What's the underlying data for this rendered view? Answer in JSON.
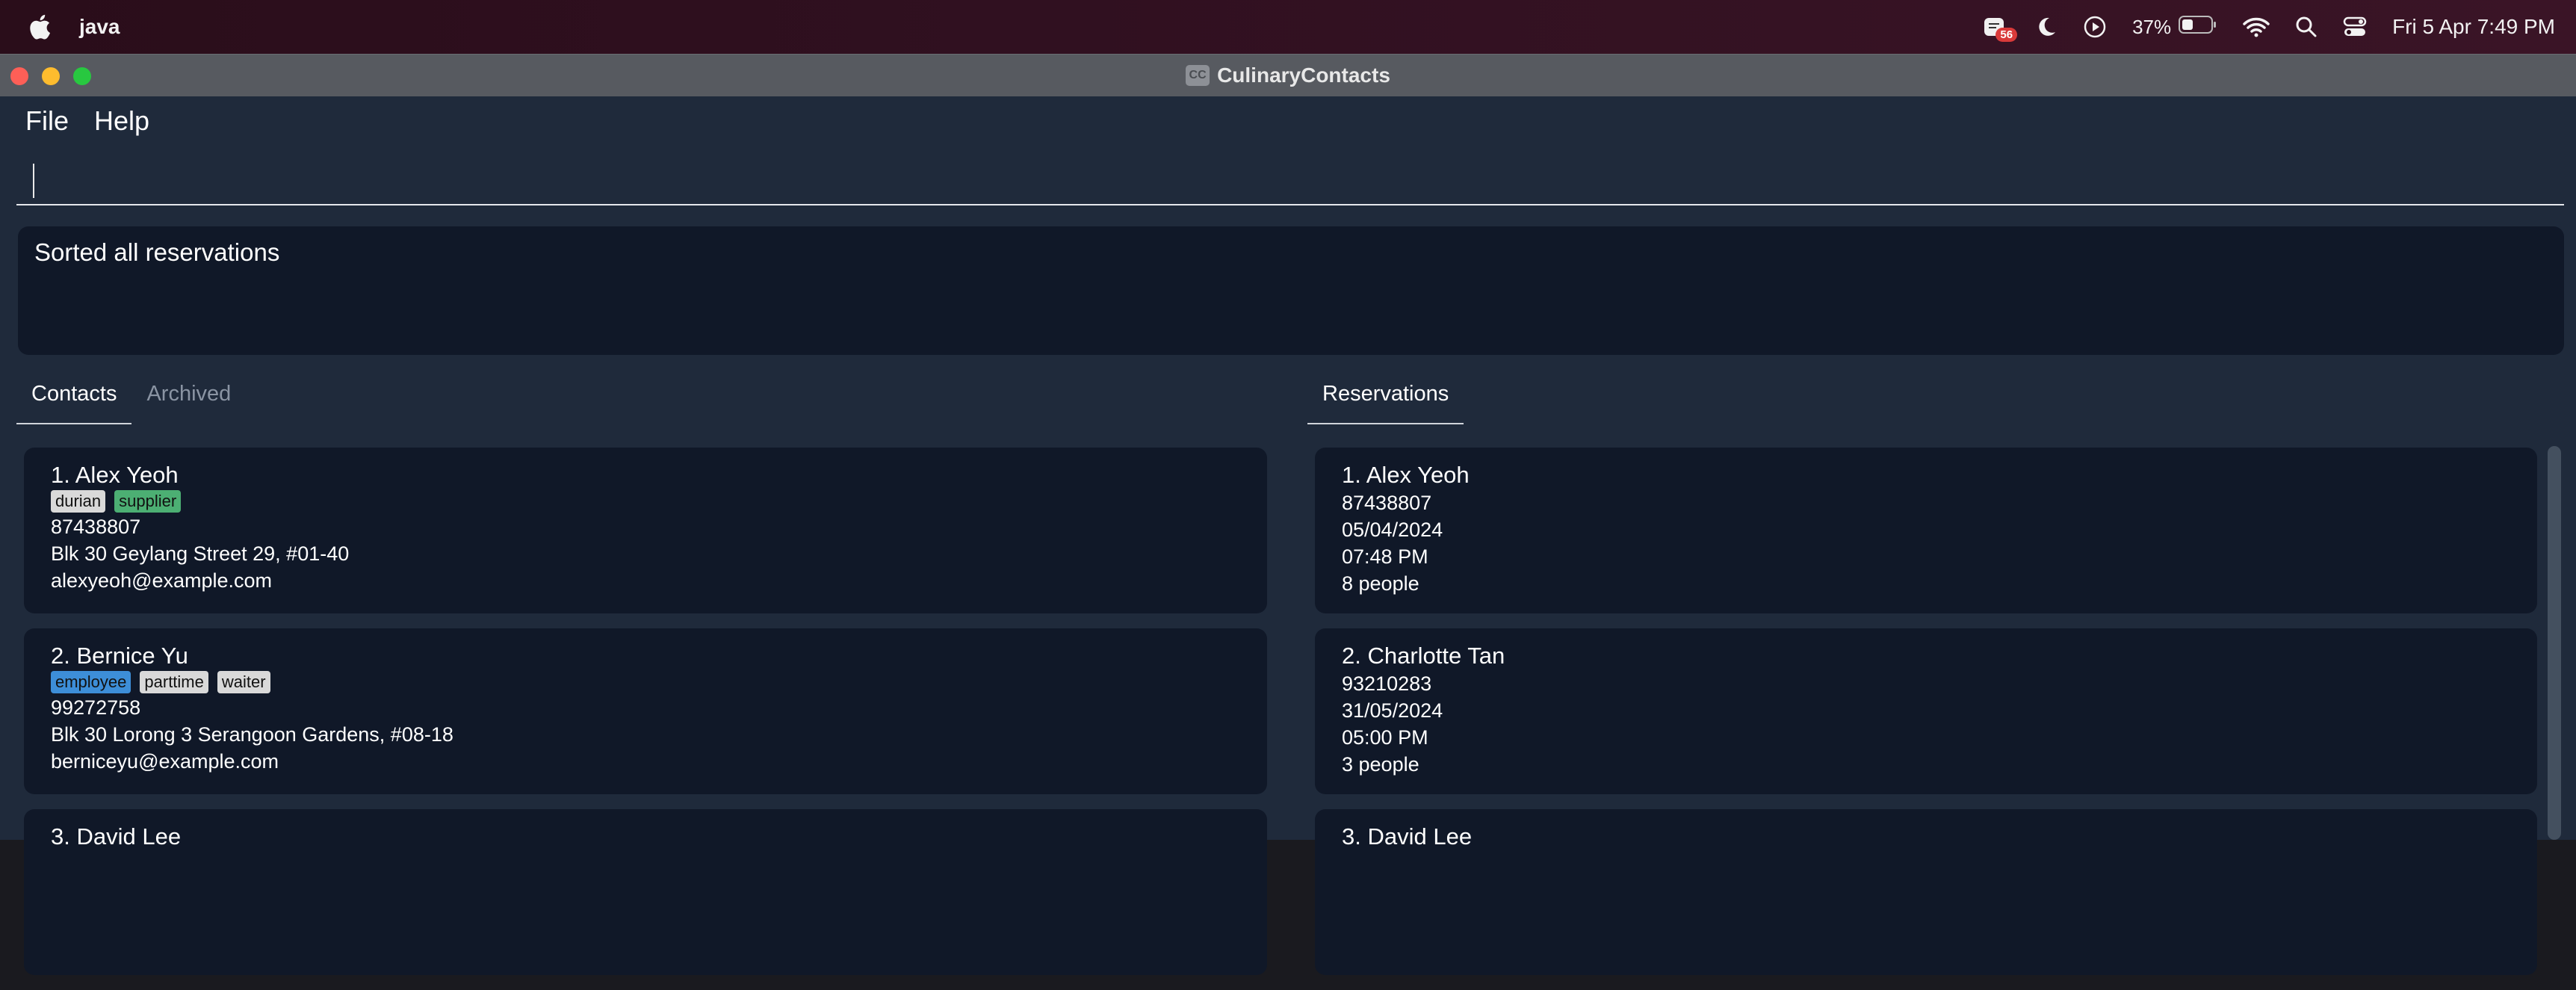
{
  "menubar": {
    "app_name": "java",
    "badge_count": "56",
    "battery_percent": "37%",
    "clock": "Fri 5 Apr  7:49 PM",
    "icons": [
      "apple-icon",
      "notification-app-icon",
      "moon-icon",
      "play-icon",
      "battery-icon",
      "wifi-icon",
      "search-icon",
      "control-center-icon"
    ]
  },
  "window": {
    "title": "CulinaryContacts",
    "app_icon_text": "CC"
  },
  "menus": [
    "File",
    "Help"
  ],
  "command": {
    "value": ""
  },
  "result": {
    "text": "Sorted all reservations"
  },
  "left_tabs": [
    {
      "label": "Contacts",
      "active": true
    },
    {
      "label": "Archived",
      "active": false
    }
  ],
  "right_tabs": [
    {
      "label": "Reservations",
      "active": true
    }
  ],
  "contacts": [
    {
      "name": "1.  Alex Yeoh",
      "tags": [
        "durian",
        "supplier"
      ],
      "phone": "87438807",
      "address": "Blk 30 Geylang Street 29, #01-40",
      "email": "alexyeoh@example.com"
    },
    {
      "name": "2.  Bernice Yu",
      "tags": [
        "employee",
        "parttime",
        "waiter"
      ],
      "phone": "99272758",
      "address": "Blk 30 Lorong 3 Serangoon Gardens, #08-18",
      "email": "berniceyu@example.com"
    },
    {
      "name": "3.  David Lee"
    }
  ],
  "reservations": [
    {
      "name": "1.  Alex Yeoh",
      "phone": "87438807",
      "date": "05/04/2024",
      "time": "07:48 PM",
      "pax": "8 people"
    },
    {
      "name": "2.  Charlotte Tan",
      "phone": "93210283",
      "date": "31/05/2024",
      "time": "05:00 PM",
      "pax": "3 people"
    },
    {
      "name": "3.  David Lee"
    }
  ],
  "colors": {
    "app_bg": "#1f2a3b",
    "panel_bg": "#101828",
    "tag_supplier": "#4caf73",
    "tag_employee": "#3d8ed8",
    "tag_default": "#d9d9d9"
  }
}
